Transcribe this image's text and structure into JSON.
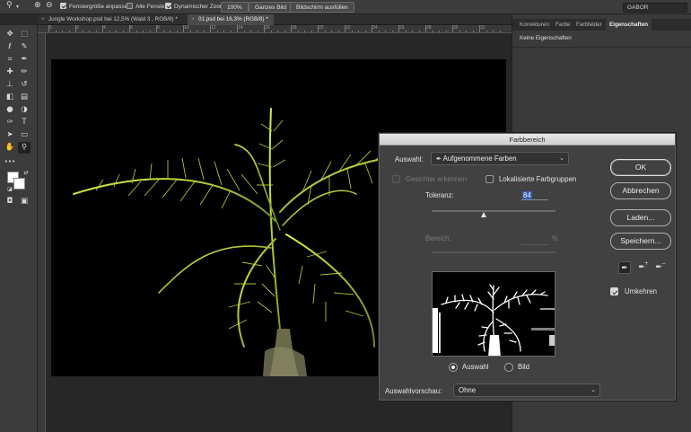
{
  "options_bar": {
    "resize_window_label": "Fenstergröße anpassen",
    "all_windows_label": "Alle Fenster",
    "scrubby_zoom_label": "Dynamischer Zoom",
    "zoom_value": "100%",
    "fit_screen_label": "Ganzes Bild",
    "fill_screen_label": "Bildschirm ausfüllen",
    "workspace_label": "GABOR",
    "resize_window_checked": true,
    "all_windows_checked": false,
    "scrubby_zoom_checked": true
  },
  "tabs": [
    {
      "label": "Jungle Workshop.psd bei 12,5% (Wald 3 , RGB/8) *",
      "active": false
    },
    {
      "label": "01.psd bei 16,3% (RGB/8) *",
      "active": true
    }
  ],
  "ruler_labels": [
    "0",
    "2",
    "4",
    "6",
    "8",
    "10",
    "12",
    "14",
    "16",
    "18",
    "20",
    "22",
    "24",
    "26",
    "28",
    "30",
    "32"
  ],
  "right_panel": {
    "tabs": [
      "Korrekturen",
      "Farbe",
      "Farbfelder",
      "Eigenschaften"
    ],
    "active_tab": "Eigenschaften",
    "content": "Keine Eigenschaften"
  },
  "dialog": {
    "title": "Farbbereich",
    "select_label": "Auswahl:",
    "select_value": "Aufgenommene Farben",
    "detect_faces_label": "Gesichter erkennen",
    "localized_clusters_label": "Lokalisierte Farbgruppen",
    "fuzziness_label": "Toleranz:",
    "fuzziness_value": "84",
    "fuzziness_slider_fraction": 0.42,
    "range_label": "Bereich:",
    "range_unit": "%",
    "selection_radio_label": "Auswahl",
    "image_radio_label": "Bild",
    "selection_radio_checked": true,
    "preview_label": "Auswahlvorschau:",
    "preview_value": "Ohne",
    "ok_label": "OK",
    "cancel_label": "Abbrechen",
    "load_label": "Laden...",
    "save_label": "Speichern...",
    "invert_label": "Umkehren",
    "invert_checked": true
  }
}
